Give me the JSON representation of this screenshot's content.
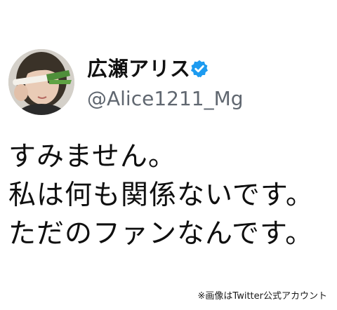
{
  "profile": {
    "display_name": "広瀬アリス",
    "handle": "@Alice1211_Mg",
    "verified": true,
    "avatar_icon": "user-avatar"
  },
  "tweet": {
    "lines": [
      "すみません。",
      "私は何も関係ないです。",
      "ただのファンなんです。"
    ]
  },
  "caption": "※画像はTwitter公式アカウント",
  "colors": {
    "verified_blue": "#1d9bf0",
    "handle_gray": "#606770",
    "text": "#0f0f0f"
  }
}
